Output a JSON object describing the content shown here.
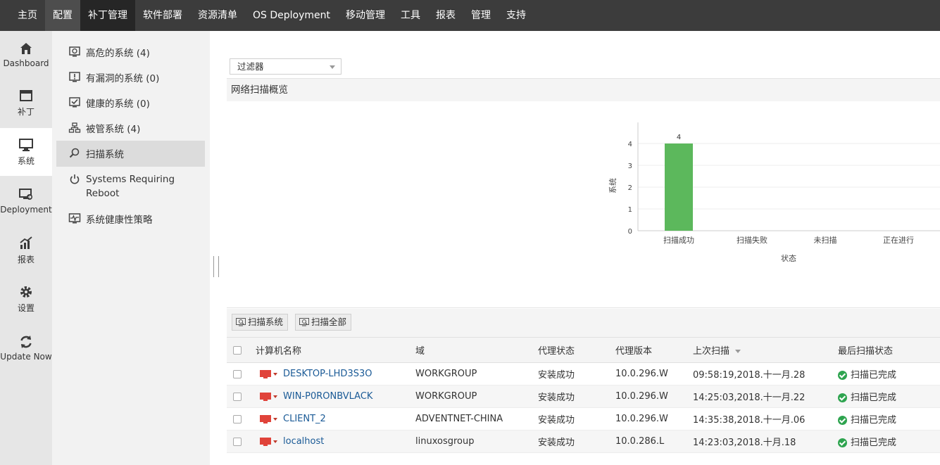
{
  "topnav": [
    "主页",
    "配置",
    "补丁管理",
    "软件部署",
    "资源清单",
    "OS Deployment",
    "移动管理",
    "工具",
    "报表",
    "管理",
    "支持"
  ],
  "iconbar": [
    {
      "label": "Dashboard",
      "icon": "home-icon"
    },
    {
      "label": "补丁",
      "icon": "patch-window-icon"
    },
    {
      "label": "系统",
      "icon": "monitor-icon"
    },
    {
      "label": "Deployment",
      "icon": "deployment-icon"
    },
    {
      "label": "报表",
      "icon": "chart-icon"
    },
    {
      "label": "设置",
      "icon": "gear-icon"
    },
    {
      "label": "Update Now",
      "icon": "refresh-icon"
    }
  ],
  "subnav": [
    {
      "label": "高危的系统 (4)",
      "icon": "high-risk-icon"
    },
    {
      "label": "有漏洞的系统 (0)",
      "icon": "vulnerable-icon"
    },
    {
      "label": "健康的系统 (0)",
      "icon": "healthy-icon"
    },
    {
      "label": "被管系统 (4)",
      "icon": "managed-icon"
    },
    {
      "label": "扫描系统",
      "icon": "search-icon"
    },
    {
      "label": "Systems Requiring Reboot",
      "icon": "power-icon"
    },
    {
      "label": "系统健康性策略",
      "icon": "health-policy-icon"
    }
  ],
  "filter": {
    "label": "过滤器"
  },
  "overview": {
    "title": "网络扫描概览"
  },
  "chart_data": {
    "type": "bar",
    "categories": [
      "扫描成功",
      "扫描失败",
      "未扫描",
      "正在进行"
    ],
    "values": [
      4,
      0,
      0,
      0
    ],
    "data_labels": [
      "4",
      "",
      "",
      ""
    ],
    "xlabel": "状态",
    "ylabel": "系统",
    "ylim": [
      0,
      4
    ],
    "yticks": [
      0,
      1,
      2,
      3,
      4
    ],
    "color": "#5cb85c",
    "grid": true
  },
  "toolbar": {
    "scan_label": "扫描系统",
    "scan_all_label": "扫描全部"
  },
  "table": {
    "headers": [
      "计算机名称",
      "域",
      "代理状态",
      "代理版本",
      "上次扫描",
      "最后扫描状态"
    ],
    "rows": [
      {
        "name": "DESKTOP-LHD3S3O",
        "domain": "WORKGROUP",
        "agent_status": "安装成功",
        "agent_version": "10.0.296.W",
        "last_scan": "09:58:19,2018.十一月.28",
        "scan_status": "扫描已完成"
      },
      {
        "name": "WIN-P0RONBVLACK",
        "domain": "WORKGROUP",
        "agent_status": "安装成功",
        "agent_version": "10.0.296.W",
        "last_scan": "14:25:03,2018.十一月.22",
        "scan_status": "扫描已完成"
      },
      {
        "name": "CLIENT_2",
        "domain": "ADVENTNET-CHINA",
        "agent_status": "安装成功",
        "agent_version": "10.0.296.W",
        "last_scan": "14:35:38,2018.十一月.06",
        "scan_status": "扫描已完成"
      },
      {
        "name": "localhost",
        "domain": "linuxosgroup",
        "agent_status": "安装成功",
        "agent_version": "10.0.286.L",
        "last_scan": "14:23:03,2018.十月.18",
        "scan_status": "扫描已完成"
      }
    ]
  }
}
